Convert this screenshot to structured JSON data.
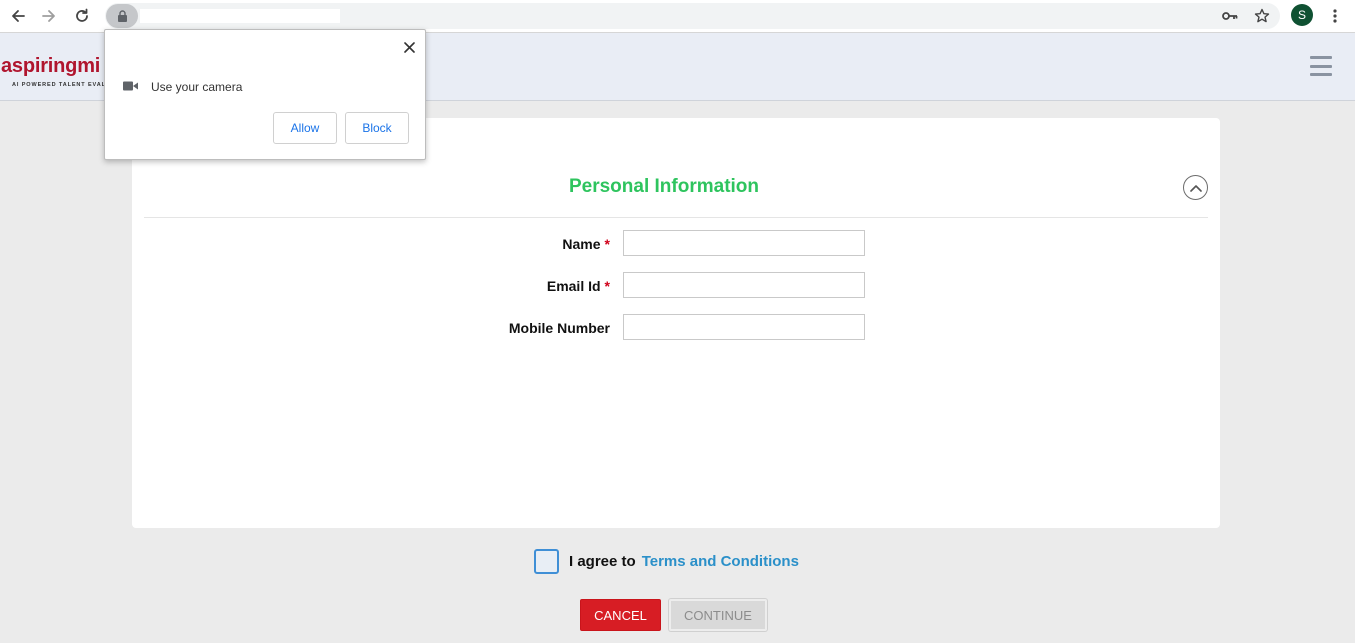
{
  "browser": {
    "avatar_initial": "S"
  },
  "site": {
    "logo_text": "aspiringmi",
    "logo_tagline": "AI POWERED TALENT EVAL"
  },
  "form": {
    "title": "Personal Information",
    "fields": [
      {
        "label": "Name",
        "required_mark": "*",
        "value": ""
      },
      {
        "label": "Email Id",
        "required_mark": "*",
        "value": ""
      },
      {
        "label": "Mobile Number",
        "required_mark": "",
        "value": ""
      }
    ]
  },
  "agreement": {
    "text": "I agree to",
    "link_text": "Terms and Conditions"
  },
  "actions": {
    "cancel_label": "CANCEL",
    "continue_label": "CONTINUE"
  },
  "permission_popup": {
    "message": "Use your camera",
    "allow_label": "Allow",
    "block_label": "Block"
  },
  "colors": {
    "accent_green": "#2ec45e",
    "link_blue": "#2b90c9",
    "cancel_red": "#d71d24",
    "brand_red": "#b0152e"
  },
  "icons": {
    "back": "arrow-left-icon",
    "forward": "arrow-right-icon",
    "reload": "reload-icon",
    "lock": "lock-icon",
    "key": "key-icon",
    "bookmark": "star-icon",
    "menu": "vertical-dots-icon",
    "hamburger": "hamburger-icon",
    "collapse": "chevron-up-icon",
    "camera": "video-camera-icon",
    "close": "close-icon"
  }
}
